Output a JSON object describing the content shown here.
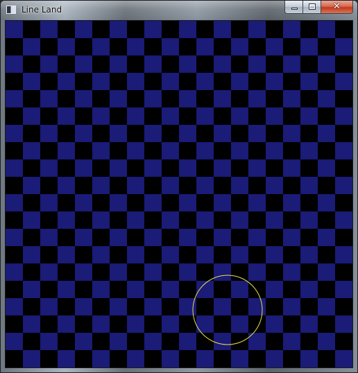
{
  "window": {
    "title": "Line Land"
  },
  "caption_buttons": {
    "minimize_icon": "minimize-icon",
    "maximize_icon": "maximize-icon",
    "close_icon": "close-icon",
    "close_glyph": "✕"
  },
  "board": {
    "rows": 20,
    "cols": 20,
    "color_a": "#1b1b78",
    "color_b": "#000000",
    "first_cell_color": "color_a"
  },
  "cursor": {
    "shape": "circle",
    "stroke": "#e8e34a",
    "fill": "none"
  }
}
